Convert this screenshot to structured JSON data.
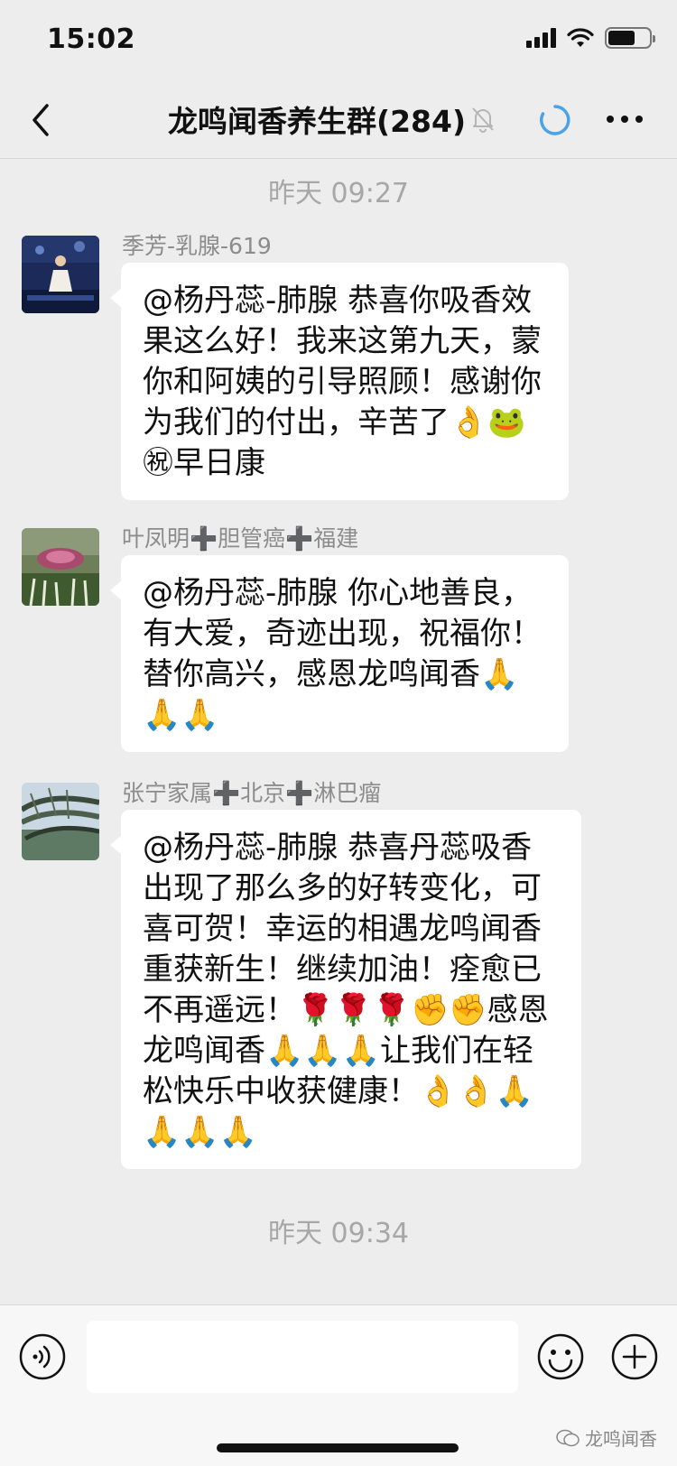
{
  "status_bar": {
    "time": "15:02"
  },
  "nav": {
    "title": "龙鸣闻香养生群(284)"
  },
  "timestamps": [
    "昨天 09:27",
    "昨天 09:34"
  ],
  "messages": [
    {
      "sender": "季芳-乳腺-619",
      "text": "@杨丹蕊-肺腺 恭喜你吸香效果这么好！我来这第九天，蒙你和阿姨的引导照顾！感谢你为我们的付出，辛苦了👌🐸㊗早日康"
    },
    {
      "sender": "叶凤明➕胆管癌➕福建",
      "text": "@杨丹蕊-肺腺 你心地善良，有大爱，奇迹出现，祝福你！替你高兴，感恩龙鸣闻香🙏🙏🙏"
    },
    {
      "sender": "张宁家属➕北京➕淋巴瘤",
      "text": "@杨丹蕊-肺腺 恭喜丹蕊吸香出现了那么多的好转变化，可喜可贺！幸运的相遇龙鸣闻香重获新生！继续加油！痊愈已不再遥远！🌹🌹🌹✊✊感恩龙鸣闻香🙏🙏🙏让我们在轻松快乐中收获健康！👌👌🙏🙏🙏🙏"
    }
  ],
  "watermark": "龙鸣闻香",
  "colors": {
    "background": "#ededed",
    "bubble": "#ffffff",
    "timestamp": "#a7a7a7",
    "sender": "#8c8c8c",
    "loading": "#4aa3e6"
  }
}
